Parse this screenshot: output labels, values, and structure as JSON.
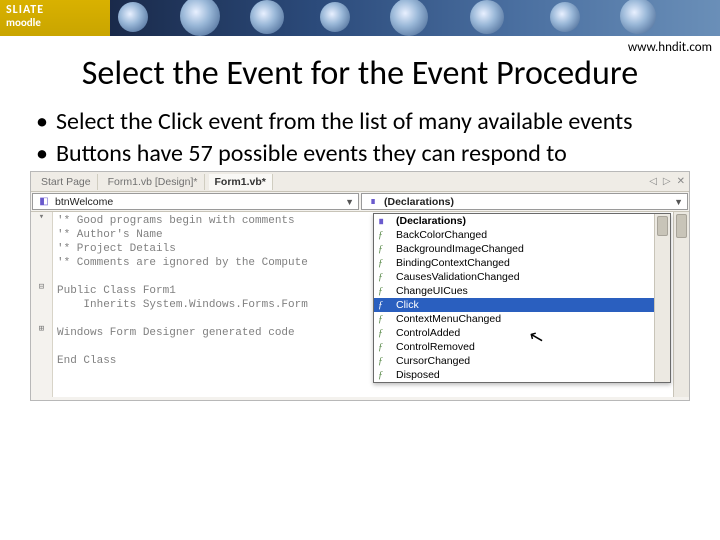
{
  "banner": {
    "line1": "SLIATE",
    "line2": "moodle"
  },
  "url": "www.hndit.com",
  "title": "Select the Event for the Event Procedure",
  "bullets": [
    "Select the Click event from the list of many available events",
    "Buttons have 57 possible events they can respond to"
  ],
  "vs": {
    "tabs": {
      "t1": "Start Page",
      "t2": "Form1.vb [Design]*",
      "t3": "Form1.vb*"
    },
    "tab_icons": {
      "back": "◁",
      "fwd": "▷",
      "close": "✕"
    },
    "left_combo": "btnWelcome",
    "right_combo": "(Declarations)",
    "code_lines": [
      "'* Good programs begin with comments",
      "'* Author's Name",
      "'* Project Details",
      "'* Comments are ignored by the Compute",
      "",
      "Public Class Form1",
      "    Inherits System.Windows.Forms.Form",
      "",
      "Windows Form Designer generated code",
      "",
      "End Class"
    ],
    "gutter_marks": [
      "▾",
      "",
      "",
      "",
      "",
      "⊟",
      "",
      "",
      "⊞",
      "",
      ""
    ]
  },
  "dropdown": {
    "items": [
      {
        "label": "(Declarations)",
        "head": true
      },
      {
        "label": "BackColorChanged"
      },
      {
        "label": "BackgroundImageChanged"
      },
      {
        "label": "BindingContextChanged"
      },
      {
        "label": "CausesValidationChanged"
      },
      {
        "label": "ChangeUICues"
      },
      {
        "label": "Click",
        "selected": true
      },
      {
        "label": "ContextMenuChanged"
      },
      {
        "label": "ControlAdded"
      },
      {
        "label": "ControlRemoved"
      },
      {
        "label": "CursorChanged"
      },
      {
        "label": "Disposed"
      }
    ]
  }
}
